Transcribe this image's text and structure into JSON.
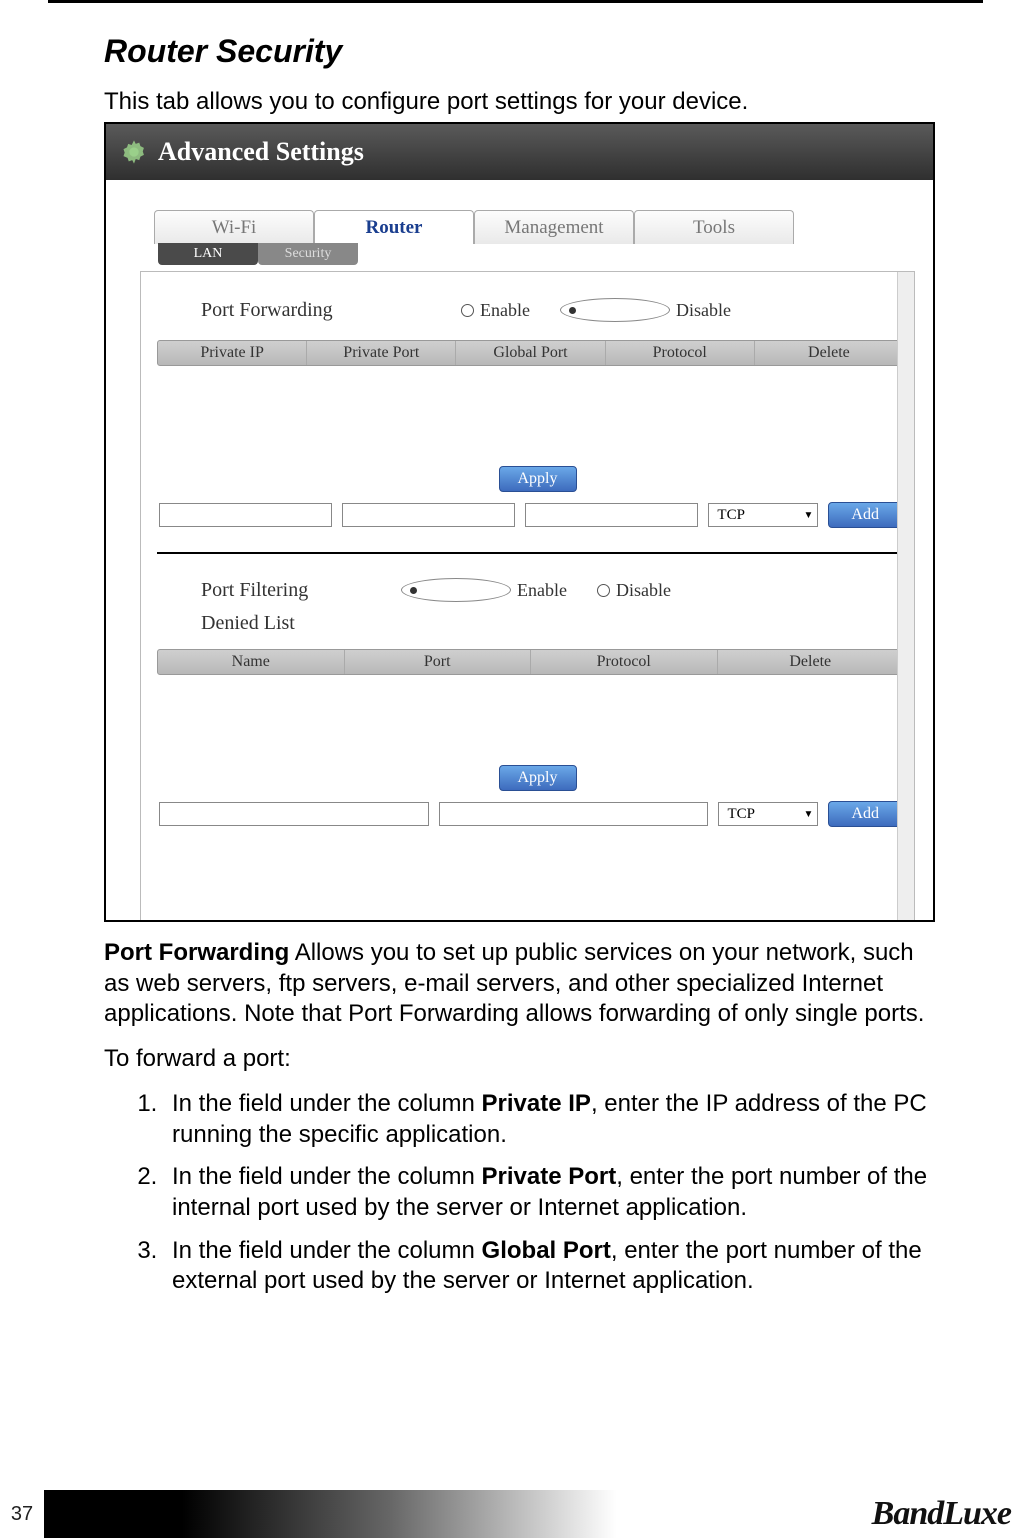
{
  "page_number": "37",
  "section_title": "Router Security",
  "intro_text": "This tab allows you to configure port settings for your device.",
  "screenshot": {
    "titlebar": "Advanced Settings",
    "main_tabs": [
      "Wi-Fi",
      "Router",
      "Management",
      "Tools"
    ],
    "main_tab_active_index": 1,
    "sub_tabs": [
      "LAN",
      "Security"
    ],
    "sub_tab_active_index": 1,
    "port_forwarding": {
      "label": "Port Forwarding",
      "enable_label": "Enable",
      "disable_label": "Disable",
      "selected": "Disable",
      "columns": [
        "Private IP",
        "Private Port",
        "Global Port",
        "Protocol",
        "Delete"
      ],
      "apply_label": "Apply",
      "protocol_value": "TCP",
      "add_label": "Add"
    },
    "port_filtering": {
      "label": "Port Filtering",
      "enable_label": "Enable",
      "disable_label": "Disable",
      "selected": "Enable",
      "denied_label": "Denied List",
      "columns": [
        "Name",
        "Port",
        "Protocol",
        "Delete"
      ],
      "apply_label": "Apply",
      "protocol_value": "TCP",
      "add_label": "Add"
    }
  },
  "body": {
    "pf_heading": "Port Forwarding",
    "pf_text": " Allows you to set up public services on your network, such as web servers, ftp servers, e-mail servers, and other specialized Internet applications. Note that Port Forwarding allows forwarding of only single ports.",
    "to_forward": "To forward a port:",
    "steps": [
      {
        "pre": "In the field under the column ",
        "b": "Private IP",
        "post": ", enter the IP address of the PC running the specific application."
      },
      {
        "pre": "In the field under the column ",
        "b": "Private Port",
        "post": ", enter the port number of the internal port used by the server or Internet application."
      },
      {
        "pre": "In the field under the column ",
        "b": "Global Port",
        "post": ", enter the port number of the external port used by the server or Internet application."
      }
    ]
  },
  "brand": "BandLuxe"
}
